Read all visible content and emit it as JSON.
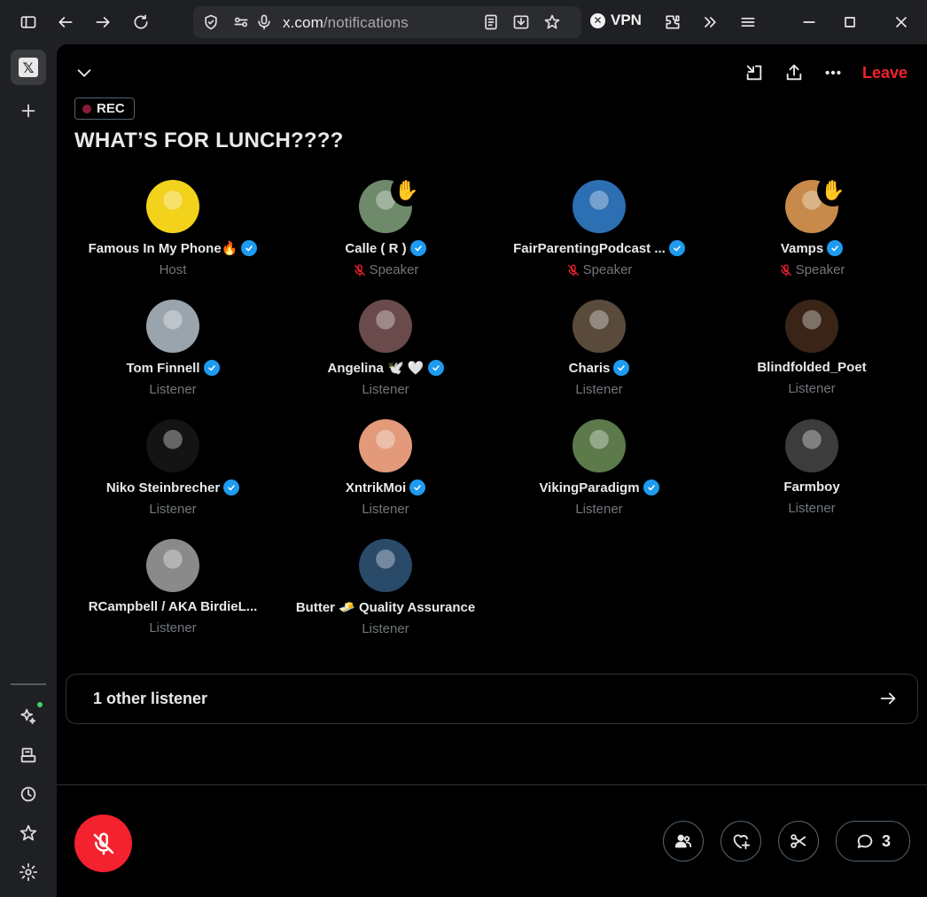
{
  "browser": {
    "url_host": "x.com",
    "url_path": "/notifications",
    "vpn_label": "VPN"
  },
  "space": {
    "rec_label": "REC",
    "title": "WHAT’S FOR LUNCH????",
    "leave_label": "Leave",
    "participants": [
      {
        "name": "Famous In My Phone🔥",
        "role": "Host",
        "verified": true,
        "muted": false,
        "hand": false,
        "avatar_color": "#f2d21b"
      },
      {
        "name": "Calle ( R )",
        "role": "Speaker",
        "verified": true,
        "muted": true,
        "hand": true,
        "avatar_color": "#6e8a6a"
      },
      {
        "name": "FairParentingPodcast ...",
        "role": "Speaker",
        "verified": true,
        "muted": true,
        "hand": false,
        "avatar_color": "#2c6fb3"
      },
      {
        "name": "Vamps",
        "role": "Speaker",
        "verified": true,
        "muted": true,
        "hand": true,
        "avatar_color": "#c88a4a"
      },
      {
        "name": "Tom Finnell",
        "role": "Listener",
        "verified": true,
        "muted": false,
        "hand": false,
        "avatar_color": "#9aa4ad"
      },
      {
        "name": "Angelina 🕊️ 🤍",
        "role": "Listener",
        "verified": true,
        "muted": false,
        "hand": false,
        "avatar_color": "#6a4a4a"
      },
      {
        "name": "Charis",
        "role": "Listener",
        "verified": true,
        "muted": false,
        "hand": false,
        "avatar_color": "#5a4a3c"
      },
      {
        "name": "Blindfolded_Poet",
        "role": "Listener",
        "verified": false,
        "muted": false,
        "hand": false,
        "avatar_color": "#3a2418"
      },
      {
        "name": "Niko Steinbrecher",
        "role": "Listener",
        "verified": true,
        "muted": false,
        "hand": false,
        "avatar_color": "#141414"
      },
      {
        "name": "XntrikMoi",
        "role": "Listener",
        "verified": true,
        "muted": false,
        "hand": false,
        "avatar_color": "#e29a7a"
      },
      {
        "name": "VikingParadigm",
        "role": "Listener",
        "verified": true,
        "muted": false,
        "hand": false,
        "avatar_color": "#5c7a4a"
      },
      {
        "name": "Farmboy",
        "role": "Listener",
        "verified": false,
        "muted": false,
        "hand": false,
        "avatar_color": "#3c3c3c"
      },
      {
        "name": "RCampbell / AKA BirdieL...",
        "role": "Listener",
        "verified": false,
        "muted": false,
        "hand": false,
        "avatar_color": "#8a8a8a"
      },
      {
        "name": "Butter 🧈 Quality Assurance",
        "role": "Listener",
        "verified": false,
        "muted": false,
        "hand": false,
        "avatar_color": "#2a4a6a"
      }
    ],
    "other_listeners_label": "1 other listener",
    "comment_count": "3"
  },
  "icons": {
    "sidebar": [
      "x-logo-icon",
      "plus-icon",
      "sparkle-icon",
      "wallet-icon",
      "history-icon",
      "star-icon",
      "settings-icon"
    ],
    "header": [
      "chevron-down-icon",
      "pip-icon",
      "share-icon",
      "more-icon"
    ],
    "footer": [
      "muted-mic-icon",
      "people-icon",
      "heart-plus-icon",
      "scissors-icon",
      "comment-icon"
    ]
  }
}
